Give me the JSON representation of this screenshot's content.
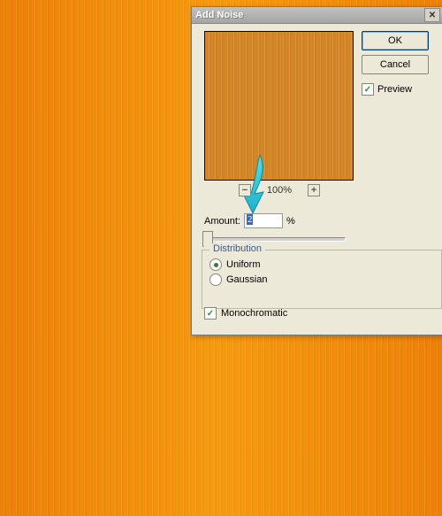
{
  "dialog": {
    "title": "Add Noise",
    "ok_label": "OK",
    "cancel_label": "Cancel",
    "preview_label": "Preview",
    "preview_checked": true,
    "zoom_label": "100%",
    "amount_label": "Amount:",
    "amount_value": "2",
    "amount_suffix": "%",
    "distribution": {
      "legend": "Distribution",
      "options": [
        {
          "label": "Uniform",
          "selected": true
        },
        {
          "label": "Gaussian",
          "selected": false
        }
      ]
    },
    "monochromatic_label": "Monochromatic",
    "monochromatic_checked": true
  }
}
